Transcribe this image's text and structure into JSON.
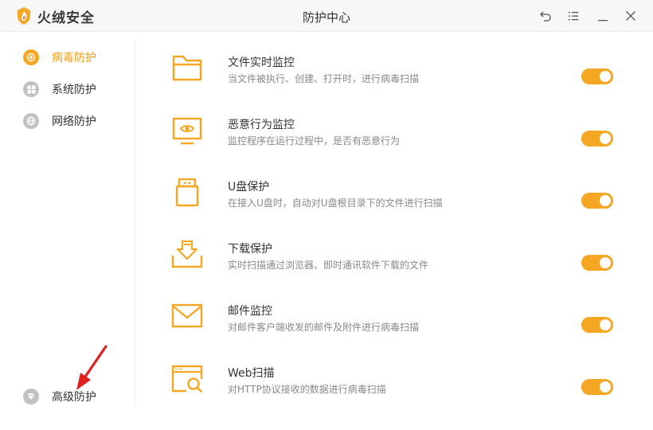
{
  "app": {
    "name": "火绒安全",
    "window_title": "防护中心"
  },
  "colors": {
    "accent": "#f5a623",
    "active_text": "#f39c12",
    "inactive_icon": "#c2c2c2",
    "annotation_arrow": "#e02020"
  },
  "window_controls": [
    {
      "name": "back-icon"
    },
    {
      "name": "menu-icon"
    },
    {
      "name": "minimize-icon"
    },
    {
      "name": "close-icon"
    }
  ],
  "sidebar": {
    "items": [
      {
        "label": "病毒防护",
        "icon": "shield-plus-icon",
        "active": true
      },
      {
        "label": "系统防护",
        "icon": "windows-icon",
        "active": false
      },
      {
        "label": "网络防护",
        "icon": "globe-icon",
        "active": false
      }
    ],
    "bottom_item": {
      "label": "高级防护",
      "icon": "diamond-icon",
      "active": false
    }
  },
  "features": [
    {
      "title": "文件实时监控",
      "desc": "当文件被执行、创建、打开时，进行病毒扫描",
      "icon": "folder-icon",
      "enabled": true
    },
    {
      "title": "恶意行为监控",
      "desc": "监控程序在运行过程中，是否有恶意行为",
      "icon": "monitor-eye-icon",
      "enabled": true
    },
    {
      "title": "U盘保护",
      "desc": "在接入U盘时，自动对U盘根目录下的文件进行扫描",
      "icon": "usb-icon",
      "enabled": true
    },
    {
      "title": "下载保护",
      "desc": "实时扫描通过浏览器、即时通讯软件下载的文件",
      "icon": "download-icon",
      "enabled": true
    },
    {
      "title": "邮件监控",
      "desc": "对邮件客户端收发的邮件及附件进行病毒扫描",
      "icon": "mail-icon",
      "enabled": true
    },
    {
      "title": "Web扫描",
      "desc": "对HTTP协议接收的数据进行病毒扫描",
      "icon": "web-scan-icon",
      "enabled": true
    }
  ]
}
